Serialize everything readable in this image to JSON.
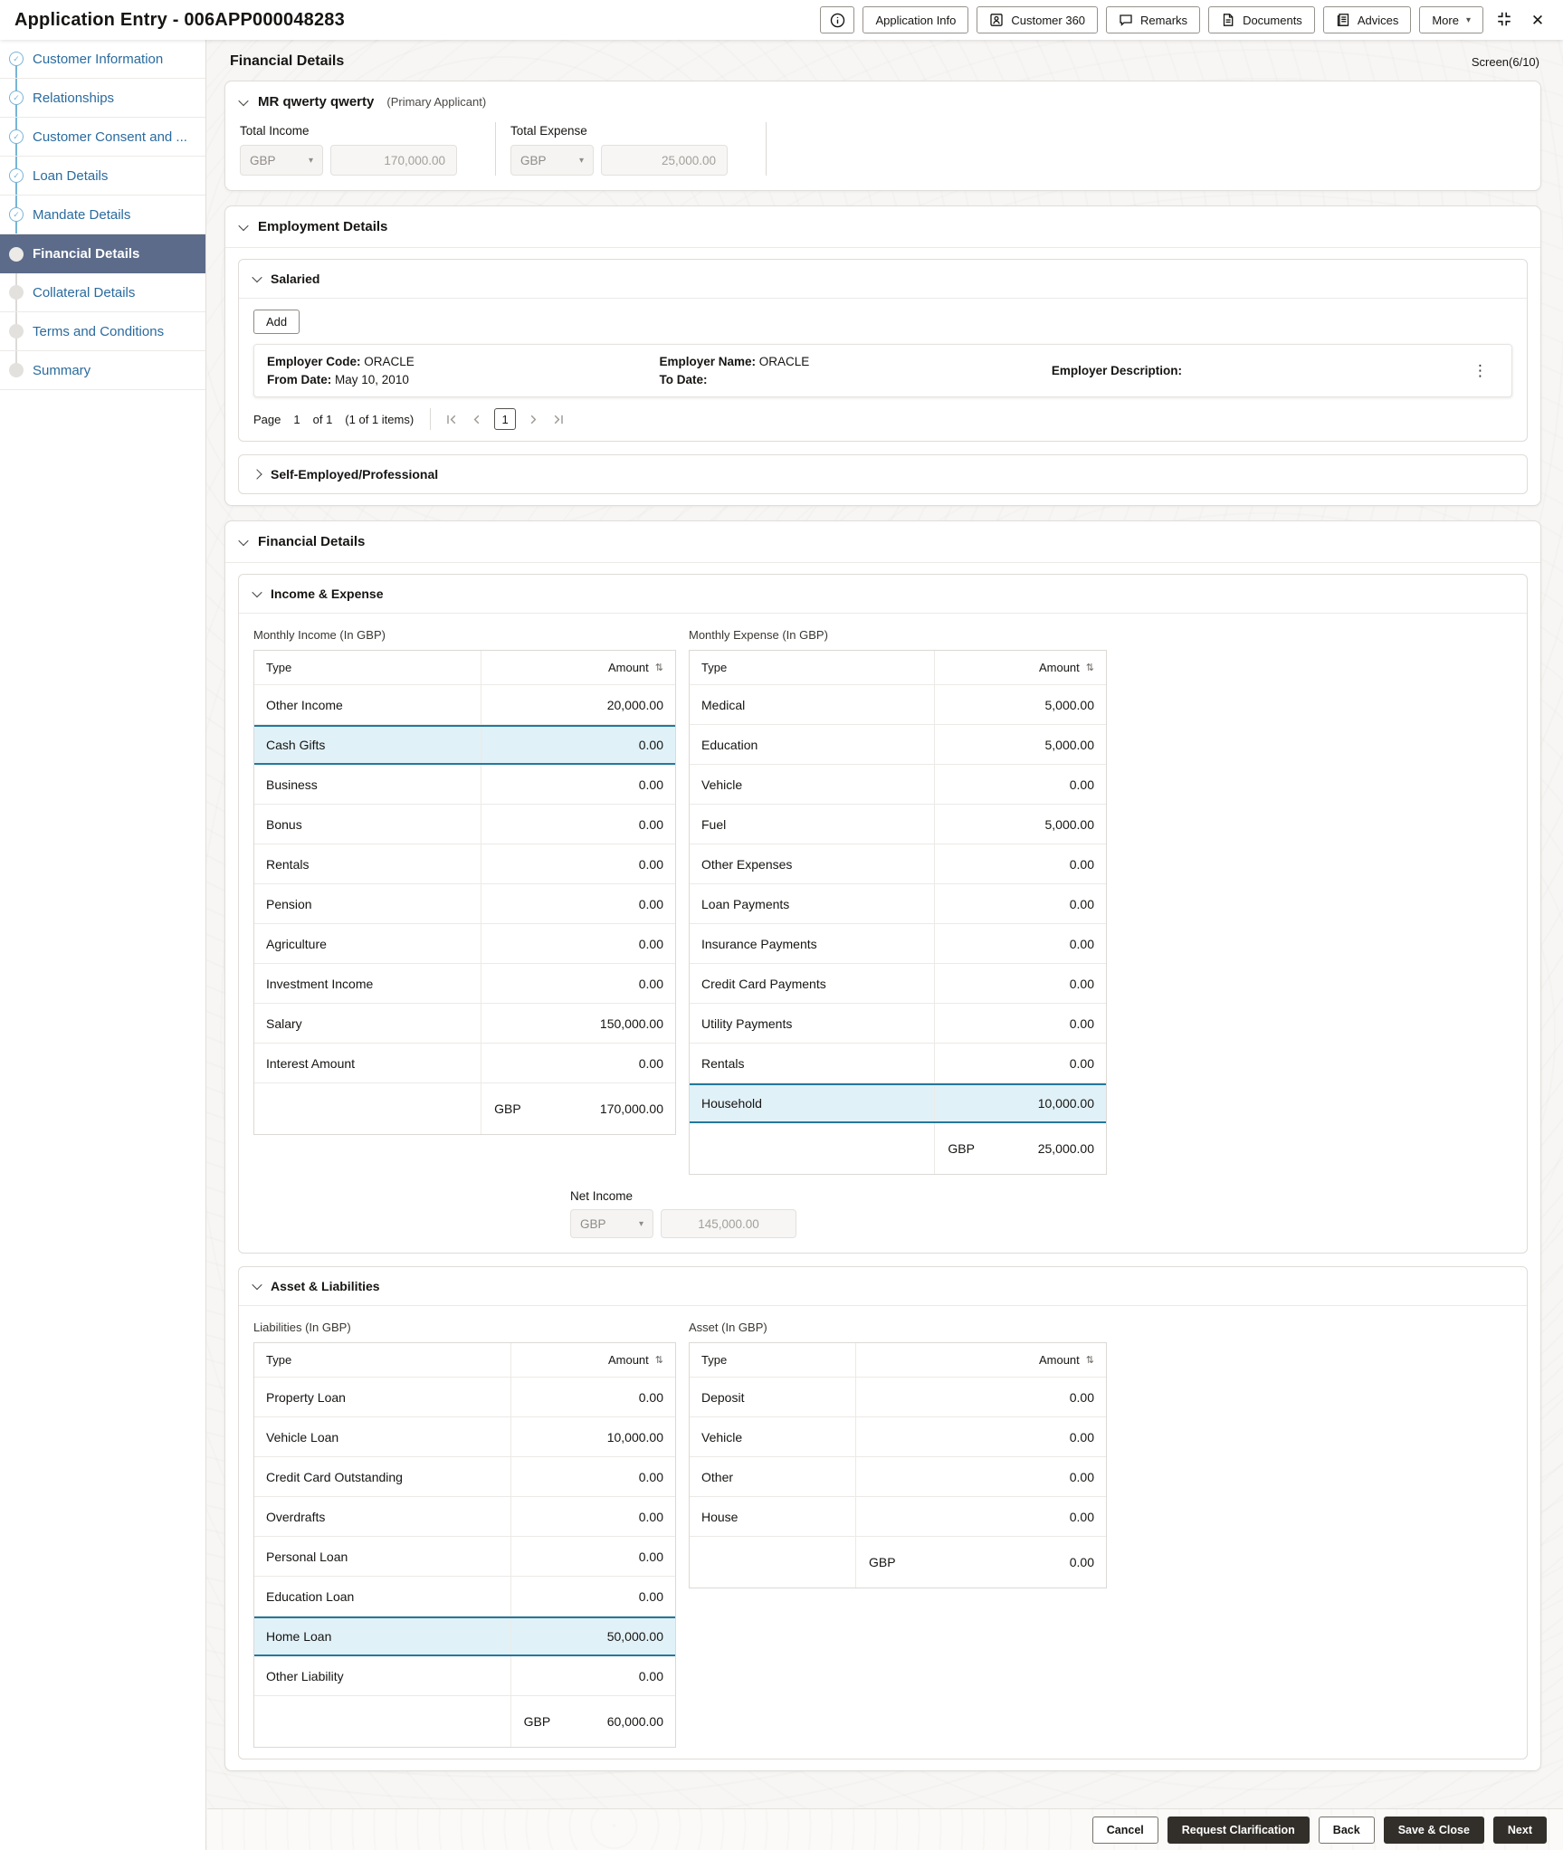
{
  "icons": {
    "check": "✓",
    "close": "✕",
    "more_caret": "▾",
    "kebab": "⋮",
    "sort": "⇅"
  },
  "colors": {
    "link_blue": "#2a6b9e",
    "active_step_bg": "#5c6b89",
    "selected_row_bg": "#e1f1f8",
    "selected_row_border": "#23799e",
    "dark_button_bg": "#322e2a",
    "completed_check_blue": "#79b4d6"
  },
  "header": {
    "title": "Application Entry - 006APP000048283",
    "buttons": {
      "application_info": "Application Info",
      "customer_360": "Customer 360",
      "remarks": "Remarks",
      "documents": "Documents",
      "advices": "Advices",
      "more": "More"
    }
  },
  "sidebar": {
    "items": [
      {
        "label": "Customer Information",
        "state": "completed"
      },
      {
        "label": "Relationships",
        "state": "completed"
      },
      {
        "label": "Customer Consent and ...",
        "state": "completed"
      },
      {
        "label": "Loan Details",
        "state": "completed"
      },
      {
        "label": "Mandate Details",
        "state": "completed"
      },
      {
        "label": "Financial Details",
        "state": "active"
      },
      {
        "label": "Collateral Details",
        "state": "pending"
      },
      {
        "label": "Terms and Conditions",
        "state": "pending"
      },
      {
        "label": "Summary",
        "state": "pending"
      }
    ]
  },
  "page": {
    "title": "Financial Details",
    "screen_indicator": "Screen(6/10)"
  },
  "applicant": {
    "name": "MR qwerty qwerty",
    "role": "(Primary Applicant)",
    "total_income": {
      "label": "Total Income",
      "currency": "GBP",
      "amount": "170,000.00"
    },
    "total_expense": {
      "label": "Total Expense",
      "currency": "GBP",
      "amount": "25,000.00"
    }
  },
  "employment": {
    "title": "Employment Details",
    "salaried": {
      "title": "Salaried",
      "add_label": "Add",
      "record": {
        "employer_code_label": "Employer Code:",
        "employer_code": "ORACLE",
        "from_date_label": "From Date:",
        "from_date": "May 10, 2010",
        "employer_name_label": "Employer Name:",
        "employer_name": "ORACLE",
        "to_date_label": "To Date:",
        "to_date": "",
        "employer_description_label": "Employer Description:",
        "employer_description": ""
      },
      "pagination": {
        "page_label": "Page",
        "current_page": "1",
        "of_label": "of 1",
        "items_label": "(1 of 1 items)"
      }
    },
    "self_employed_title": "Self-Employed/Professional"
  },
  "financial": {
    "title": "Financial Details",
    "income_expense": {
      "title": "Income & Expense",
      "net_income": {
        "label": "Net Income",
        "currency": "GBP",
        "amount": "145,000.00"
      },
      "income_table": {
        "caption": "Monthly Income (In GBP)",
        "col_type": "Type",
        "col_amount": "Amount",
        "rows": [
          {
            "type": "Other Income",
            "amount": "20,000.00"
          },
          {
            "type": "Cash Gifts",
            "amount": "0.00",
            "selected": true
          },
          {
            "type": "Business",
            "amount": "0.00"
          },
          {
            "type": "Bonus",
            "amount": "0.00"
          },
          {
            "type": "Rentals",
            "amount": "0.00"
          },
          {
            "type": "Pension",
            "amount": "0.00"
          },
          {
            "type": "Agriculture",
            "amount": "0.00"
          },
          {
            "type": "Investment Income",
            "amount": "0.00"
          },
          {
            "type": "Salary",
            "amount": "150,000.00"
          },
          {
            "type": "Interest Amount",
            "amount": "0.00"
          }
        ],
        "total_currency": "GBP",
        "total_amount": "170,000.00"
      },
      "expense_table": {
        "caption": "Monthly Expense (In GBP)",
        "col_type": "Type",
        "col_amount": "Amount",
        "rows": [
          {
            "type": "Medical",
            "amount": "5,000.00"
          },
          {
            "type": "Education",
            "amount": "5,000.00"
          },
          {
            "type": "Vehicle",
            "amount": "0.00"
          },
          {
            "type": "Fuel",
            "amount": "5,000.00"
          },
          {
            "type": "Other Expenses",
            "amount": "0.00"
          },
          {
            "type": "Loan Payments",
            "amount": "0.00"
          },
          {
            "type": "Insurance Payments",
            "amount": "0.00"
          },
          {
            "type": "Credit Card Payments",
            "amount": "0.00"
          },
          {
            "type": "Utility Payments",
            "amount": "0.00"
          },
          {
            "type": "Rentals",
            "amount": "0.00"
          },
          {
            "type": "Household",
            "amount": "10,000.00",
            "selected": true
          }
        ],
        "total_currency": "GBP",
        "total_amount": "25,000.00"
      }
    },
    "asset_liabilities": {
      "title": "Asset & Liabilities",
      "liabilities_table": {
        "caption": "Liabilities (In GBP)",
        "col_type": "Type",
        "col_amount": "Amount",
        "rows": [
          {
            "type": "Property Loan",
            "amount": "0.00"
          },
          {
            "type": "Vehicle Loan",
            "amount": "10,000.00"
          },
          {
            "type": "Credit Card Outstanding",
            "amount": "0.00"
          },
          {
            "type": "Overdrafts",
            "amount": "0.00"
          },
          {
            "type": "Personal Loan",
            "amount": "0.00"
          },
          {
            "type": "Education Loan",
            "amount": "0.00"
          },
          {
            "type": "Home Loan",
            "amount": "50,000.00",
            "selected": true
          },
          {
            "type": "Other Liability",
            "amount": "0.00"
          }
        ],
        "total_currency": "GBP",
        "total_amount": "60,000.00"
      },
      "asset_table": {
        "caption": "Asset (In GBP)",
        "col_type": "Type",
        "col_amount": "Amount",
        "rows": [
          {
            "type": "Deposit",
            "amount": "0.00"
          },
          {
            "type": "Vehicle",
            "amount": "0.00"
          },
          {
            "type": "Other",
            "amount": "0.00"
          },
          {
            "type": "House",
            "amount": "0.00"
          }
        ],
        "total_currency": "GBP",
        "total_amount": "0.00"
      }
    }
  },
  "footer": {
    "buttons": [
      {
        "label": "Cancel",
        "style": "outline"
      },
      {
        "label": "Request Clarification",
        "style": "solid"
      },
      {
        "label": "Back",
        "style": "outline"
      },
      {
        "label": "Save & Close",
        "style": "solid"
      },
      {
        "label": "Next",
        "style": "solid"
      }
    ]
  }
}
